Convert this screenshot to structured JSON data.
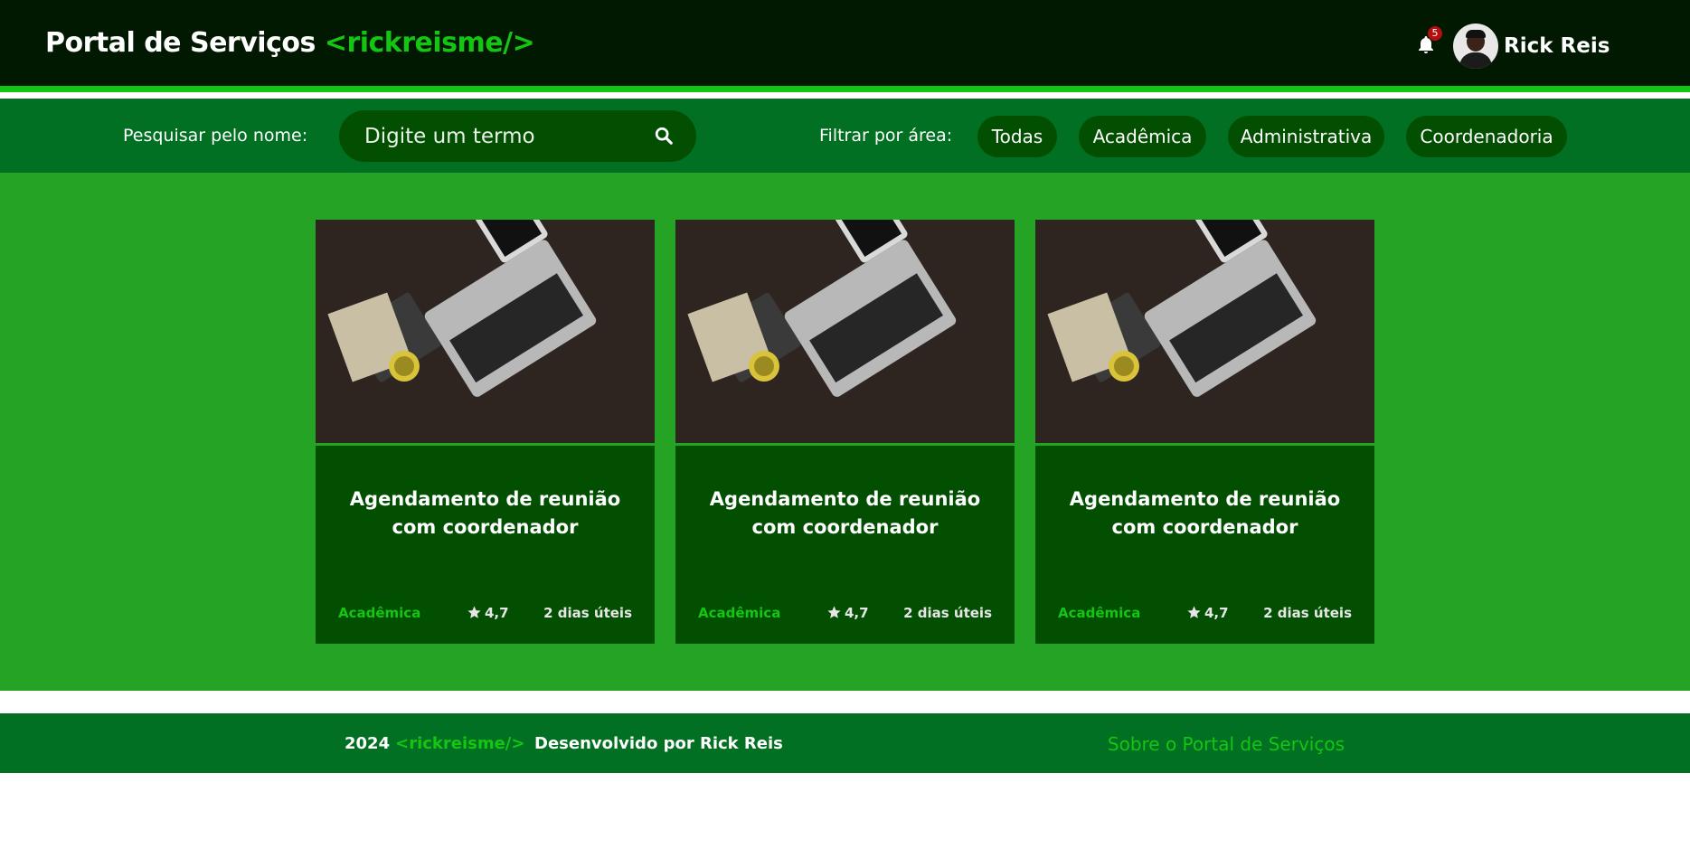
{
  "header": {
    "title": "Portal de Serviços",
    "brand_tag": "<rickreisme/>",
    "notification_count": "5",
    "user_name": "Rick Reis"
  },
  "search": {
    "label": "Pesquisar pelo nome:",
    "placeholder": "Digite um termo"
  },
  "filter": {
    "label": "Filtrar por área:",
    "options": [
      "Todas",
      "Acadêmica",
      "Administrativa",
      "Coordenadoria"
    ]
  },
  "cards": [
    {
      "title": "Agendamento de reunião com coordenador",
      "area": "Acadêmica",
      "rating": "4,7",
      "time": "2 dias úteis"
    },
    {
      "title": "Agendamento de reunião com coordenador",
      "area": "Acadêmica",
      "rating": "4,7",
      "time": "2 dias úteis"
    },
    {
      "title": "Agendamento de reunião com coordenador",
      "area": "Acadêmica",
      "rating": "4,7",
      "time": "2 dias úteis"
    }
  ],
  "footer": {
    "year": "2024",
    "brand_tag": "<rickreisme/>",
    "developed_by": "Desenvolvido por Rick Reis",
    "about_link": "Sobre o Portal de Serviços"
  },
  "colors": {
    "header_bg": "#011801",
    "accent": "#14c514",
    "bar_bg": "#027022",
    "main_bg": "#25a325",
    "card_bg": "#024f02",
    "badge": "#b30f0f"
  }
}
